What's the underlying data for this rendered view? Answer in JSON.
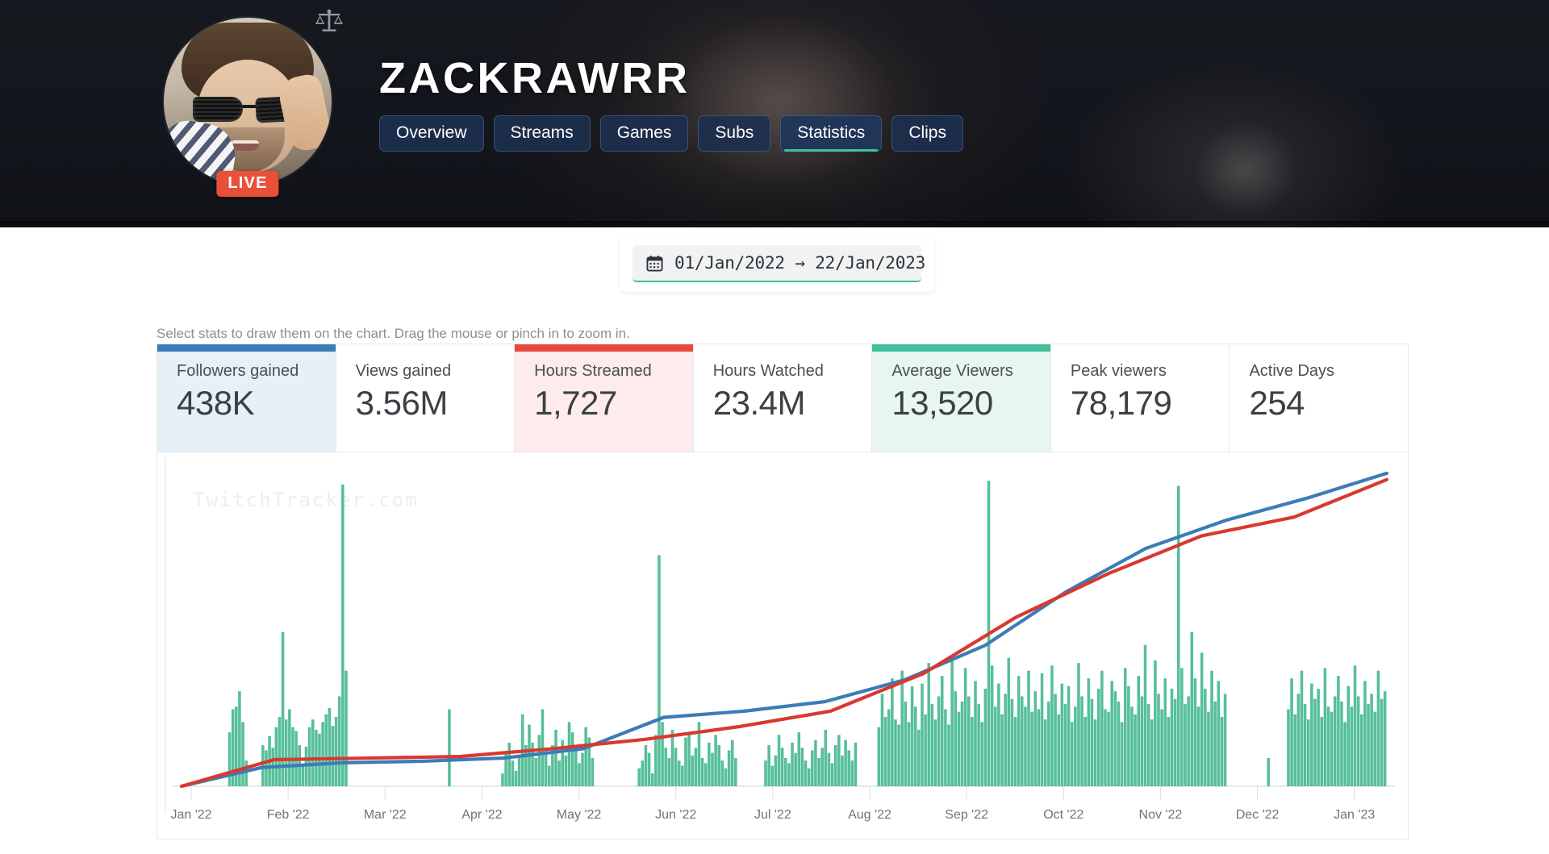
{
  "header": {
    "channel_name": "ZACKRAWRR",
    "live_badge": "LIVE",
    "scales_icon": "scales-icon",
    "avatar_icon": "avatar-image",
    "tabs": [
      {
        "label": "Overview",
        "active": false
      },
      {
        "label": "Streams",
        "active": false
      },
      {
        "label": "Games",
        "active": false
      },
      {
        "label": "Subs",
        "active": false
      },
      {
        "label": "Statistics",
        "active": true
      },
      {
        "label": "Clips",
        "active": false
      }
    ],
    "accent_active": "#3fc1a0",
    "tab_bg": "#1d3050"
  },
  "date_picker": {
    "icon": "calendar-icon",
    "start": "01/Jan/2022",
    "arrow": "→",
    "end": "22/Jan/2023",
    "display": "01/Jan/2022  →  22/Jan/2023",
    "underline_color": "#3fbfa0"
  },
  "hint": "Select stats to draw them on the chart. Drag the mouse or pinch in to zoom in.",
  "stats": [
    {
      "label": "Followers gained",
      "value": "438K",
      "accent": "#3b7cb8",
      "bg": "#e7eff7",
      "selected": true
    },
    {
      "label": "Views gained",
      "value": "3.56M",
      "accent": "#ffffff",
      "bg": "#ffffff",
      "selected": false
    },
    {
      "label": "Hours Streamed",
      "value": "1,727",
      "accent": "#e8473f",
      "bg": "#fdeceb",
      "selected": true
    },
    {
      "label": "Hours Watched",
      "value": "23.4M",
      "accent": "#ffffff",
      "bg": "#ffffff",
      "selected": false
    },
    {
      "label": "Average Viewers",
      "value": "13,520",
      "accent": "#3fbf9b",
      "bg": "#e8f6f1",
      "selected": true
    },
    {
      "label": "Peak viewers",
      "value": "78,179",
      "accent": "#ffffff",
      "bg": "#ffffff",
      "selected": false
    },
    {
      "label": "Active Days",
      "value": "254",
      "accent": "#ffffff",
      "bg": "#ffffff",
      "selected": false
    }
  ],
  "chart_watermark": "TwitchTracker.com",
  "chart_data": {
    "type": "bar",
    "title": "",
    "xlabel": "",
    "ylabel": "",
    "grid": false,
    "legend": "none",
    "x_tick_labels": [
      "Jan '22",
      "Feb '22",
      "Mar '22",
      "Apr '22",
      "May '22",
      "Jun '22",
      "Jul '22",
      "Aug '22",
      "Sep '22",
      "Oct '22",
      "Nov '22",
      "Dec '22",
      "Jan '23"
    ],
    "x_range": [
      "2022-01-01",
      "2023-01-22"
    ],
    "series": [
      {
        "name": "Hours Streamed",
        "type": "bar",
        "color": "#56bf9a",
        "unit": "hours per day",
        "ymax": 24,
        "values": [
          0,
          0,
          0,
          0,
          0,
          0,
          0,
          0,
          0,
          0,
          0,
          0,
          0,
          0,
          4.2,
          6.0,
          6.2,
          7.4,
          5.0,
          2.0,
          0,
          0,
          0,
          0,
          3.2,
          2.8,
          3.9,
          3.0,
          4.6,
          5.4,
          12.0,
          5.2,
          6.0,
          4.6,
          4.3,
          3.2,
          1.6,
          3.1,
          4.6,
          5.2,
          4.4,
          4.1,
          5.0,
          5.6,
          6.1,
          4.7,
          5.4,
          7.0,
          23.5,
          9.0,
          0,
          0,
          0,
          0,
          0,
          0,
          0,
          0,
          0,
          0,
          0,
          0,
          0,
          0,
          0,
          0,
          0,
          0,
          0,
          0,
          0,
          0,
          0,
          0,
          0,
          0,
          0,
          0,
          0,
          0,
          6.0,
          0,
          0,
          0,
          0,
          0,
          0,
          0,
          0,
          0,
          0,
          0,
          0,
          0,
          0,
          0,
          1.0,
          2.6,
          3.4,
          2.0,
          1.2,
          2.4,
          5.6,
          3.2,
          4.8,
          3.4,
          2.2,
          4.0,
          6.0,
          2.8,
          1.6,
          3.2,
          4.4,
          2.0,
          3.6,
          2.4,
          5.0,
          4.2,
          3.0,
          1.8,
          2.6,
          4.6,
          3.8,
          2.2,
          0,
          0,
          0,
          0,
          0,
          0,
          0,
          0,
          0,
          0,
          0,
          0,
          0,
          1.4,
          2.0,
          3.2,
          2.6,
          1.0,
          4.0,
          18.0,
          5.0,
          3.0,
          2.2,
          4.4,
          3.0,
          2.0,
          1.6,
          3.8,
          4.2,
          2.4,
          3.0,
          5.0,
          2.2,
          1.8,
          3.4,
          2.6,
          4.0,
          3.2,
          2.0,
          1.4,
          2.8,
          3.6,
          2.2,
          0,
          0,
          0,
          0,
          0,
          0,
          0,
          0,
          2.0,
          3.2,
          1.6,
          2.4,
          4.0,
          3.0,
          2.2,
          1.8,
          3.4,
          2.6,
          4.2,
          3.0,
          2.0,
          1.4,
          2.8,
          3.6,
          2.2,
          3.0,
          4.4,
          2.6,
          1.8,
          3.2,
          4.0,
          2.4,
          3.6,
          2.8,
          2.0,
          3.4,
          0,
          0,
          0,
          0,
          0,
          0,
          4.6,
          7.2,
          5.4,
          6.0,
          8.4,
          5.2,
          4.8,
          9.0,
          6.6,
          5.0,
          7.8,
          6.2,
          4.4,
          8.0,
          5.6,
          9.6,
          6.4,
          5.2,
          7.0,
          8.6,
          6.0,
          4.8,
          10.2,
          7.4,
          5.8,
          6.6,
          9.2,
          7.0,
          5.4,
          8.2,
          6.4,
          5.0,
          7.6,
          23.8,
          9.4,
          6.2,
          8.0,
          5.6,
          7.2,
          10.0,
          6.8,
          5.4,
          8.6,
          7.0,
          6.2,
          9.0,
          5.8,
          7.4,
          6.0,
          8.8,
          5.2,
          6.6,
          9.4,
          7.2,
          5.6,
          8.0,
          6.4,
          7.8,
          5.0,
          6.2,
          9.6,
          7.0,
          5.4,
          8.4,
          6.8,
          5.2,
          7.6,
          9.0,
          6.0,
          5.8,
          8.2,
          7.4,
          6.6,
          5.0,
          9.2,
          7.8,
          6.2,
          5.6,
          8.6,
          7.0,
          11.0,
          6.4,
          5.2,
          9.8,
          7.2,
          6.0,
          8.4,
          5.4,
          7.6,
          6.8,
          23.4,
          9.2,
          6.4,
          7.0,
          12.0,
          8.4,
          6.2,
          10.4,
          7.6,
          5.8,
          9.0,
          6.6,
          8.2,
          5.4,
          7.2,
          0,
          0,
          0,
          0,
          0,
          0,
          0,
          0,
          0,
          0,
          0,
          0,
          2.2,
          0,
          0,
          0,
          0,
          0,
          6.0,
          8.4,
          5.6,
          7.2,
          9.0,
          6.4,
          5.2,
          8.0,
          6.8,
          7.6,
          5.4,
          9.2,
          6.2,
          5.8,
          7.0,
          8.6,
          6.6,
          5.0,
          7.8,
          6.2,
          9.4,
          7.0,
          5.6,
          8.2,
          6.4,
          7.2,
          5.8,
          9.0,
          6.8,
          7.4
        ]
      },
      {
        "name": "Followers gained (cumulative)",
        "type": "line",
        "color": "#3b7cb8",
        "total": "438K",
        "keypoints": [
          {
            "x": "Jan '22",
            "y_frac": 0.0
          },
          {
            "x": "Feb '22",
            "y_frac": 0.06
          },
          {
            "x": "Mar '22",
            "y_frac": 0.075
          },
          {
            "x": "Apr '22",
            "y_frac": 0.08
          },
          {
            "x": "May '22",
            "y_frac": 0.09
          },
          {
            "x": "Jun '22",
            "y_frac": 0.12
          },
          {
            "x": "Jun 15 '22",
            "y_frac": 0.22
          },
          {
            "x": "Jul '22",
            "y_frac": 0.24
          },
          {
            "x": "Aug '22",
            "y_frac": 0.27
          },
          {
            "x": "Aug 15 '22",
            "y_frac": 0.34
          },
          {
            "x": "Sep '22",
            "y_frac": 0.45
          },
          {
            "x": "Oct '22",
            "y_frac": 0.62
          },
          {
            "x": "Nov '22",
            "y_frac": 0.76
          },
          {
            "x": "Dec '22",
            "y_frac": 0.85
          },
          {
            "x": "Jan '23",
            "y_frac": 0.92
          },
          {
            "x": "22 Jan '23",
            "y_frac": 1.0
          }
        ]
      },
      {
        "name": "Average Viewers (cumulative)",
        "type": "line",
        "color": "#d8392f",
        "total": "13,520",
        "keypoints": [
          {
            "x": "Jan '22",
            "y_frac": 0.0
          },
          {
            "x": "Feb '22",
            "y_frac": 0.085
          },
          {
            "x": "Mar '22",
            "y_frac": 0.09
          },
          {
            "x": "Apr '22",
            "y_frac": 0.095
          },
          {
            "x": "May '22",
            "y_frac": 0.12
          },
          {
            "x": "Jun '22",
            "y_frac": 0.15
          },
          {
            "x": "Jul '22",
            "y_frac": 0.19
          },
          {
            "x": "Aug '22",
            "y_frac": 0.24
          },
          {
            "x": "Sep '22",
            "y_frac": 0.36
          },
          {
            "x": "Oct '22",
            "y_frac": 0.54
          },
          {
            "x": "Nov '22",
            "y_frac": 0.68
          },
          {
            "x": "Dec '22",
            "y_frac": 0.8
          },
          {
            "x": "Jan '23",
            "y_frac": 0.86
          },
          {
            "x": "22 Jan '23",
            "y_frac": 0.98
          }
        ]
      }
    ]
  }
}
